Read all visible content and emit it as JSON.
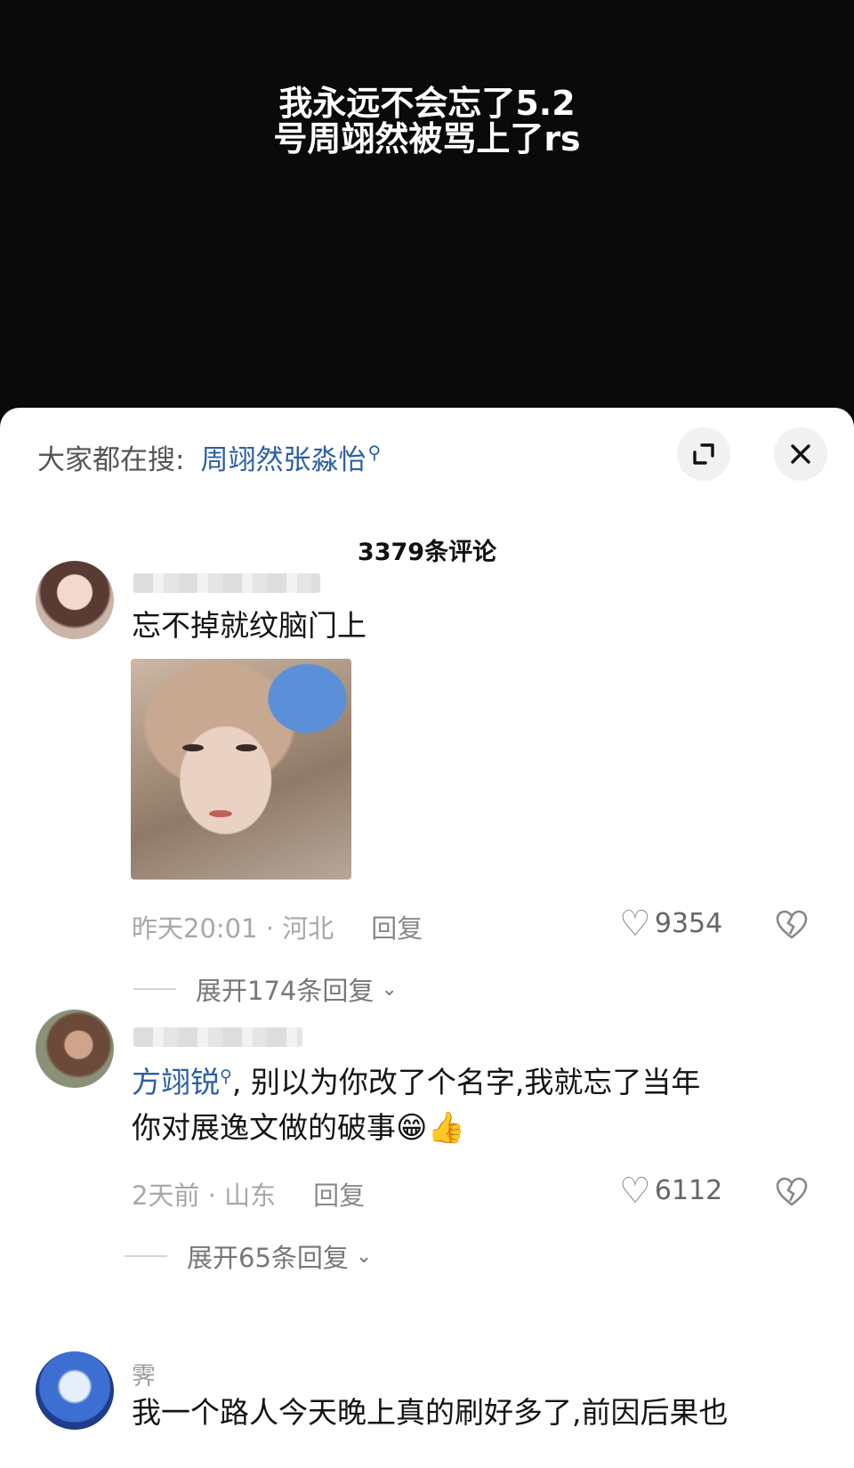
{
  "video": {
    "caption_line1": "我永远不会忘了5.2",
    "caption_line2": "号周翊然被骂上了rs"
  },
  "search": {
    "label": "大家都在搜:",
    "term": "周翊然张淼怡",
    "term_icon": "search-icon"
  },
  "header": {
    "expand_icon": "expand-icon",
    "close_icon": "close-icon",
    "comment_count": "3379条评论"
  },
  "comments": [
    {
      "text": "忘不掉就纹脑门上",
      "time": "昨天20:01 · 河北",
      "reply_label": "回复",
      "likes": "9354",
      "expand_replies": "展开174条回复"
    },
    {
      "mention": "方翊锐",
      "text_line1": ", 别以为你改了个名字,我就忘了当年",
      "text_line2": "你对展逸文做的破事",
      "emoji": "😁👍",
      "time": "2天前 · 山东",
      "reply_label": "回复",
      "likes": "6112",
      "expand_replies": "展开65条回复"
    },
    {
      "username": "霁",
      "text_line1": "我一个路人今天晚上真的刷好多了,前因后果也"
    }
  ]
}
